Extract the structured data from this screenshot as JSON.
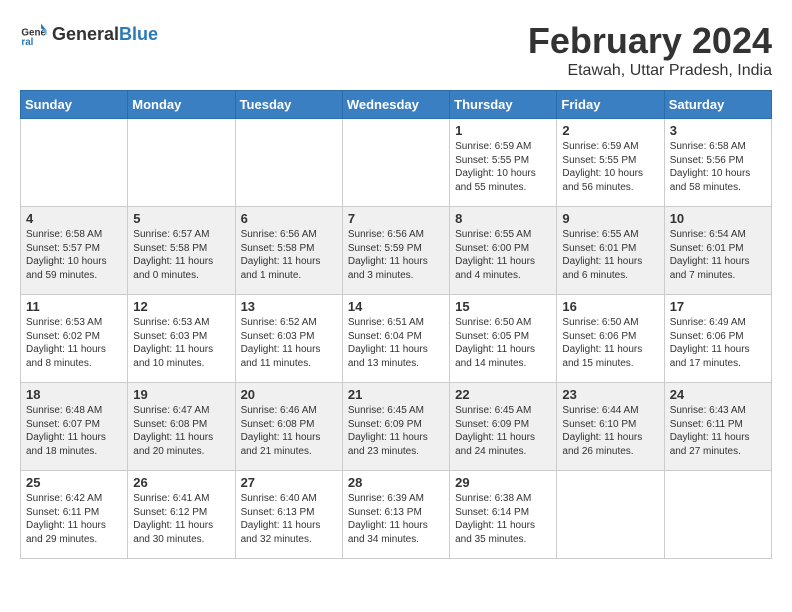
{
  "header": {
    "logo_general": "General",
    "logo_blue": "Blue",
    "month": "February 2024",
    "location": "Etawah, Uttar Pradesh, India"
  },
  "weekdays": [
    "Sunday",
    "Monday",
    "Tuesday",
    "Wednesday",
    "Thursday",
    "Friday",
    "Saturday"
  ],
  "weeks": [
    [
      {
        "day": "",
        "info": ""
      },
      {
        "day": "",
        "info": ""
      },
      {
        "day": "",
        "info": ""
      },
      {
        "day": "",
        "info": ""
      },
      {
        "day": "1",
        "info": "Sunrise: 6:59 AM\nSunset: 5:55 PM\nDaylight: 10 hours\nand 55 minutes."
      },
      {
        "day": "2",
        "info": "Sunrise: 6:59 AM\nSunset: 5:55 PM\nDaylight: 10 hours\nand 56 minutes."
      },
      {
        "day": "3",
        "info": "Sunrise: 6:58 AM\nSunset: 5:56 PM\nDaylight: 10 hours\nand 58 minutes."
      }
    ],
    [
      {
        "day": "4",
        "info": "Sunrise: 6:58 AM\nSunset: 5:57 PM\nDaylight: 10 hours\nand 59 minutes."
      },
      {
        "day": "5",
        "info": "Sunrise: 6:57 AM\nSunset: 5:58 PM\nDaylight: 11 hours\nand 0 minutes."
      },
      {
        "day": "6",
        "info": "Sunrise: 6:56 AM\nSunset: 5:58 PM\nDaylight: 11 hours\nand 1 minute."
      },
      {
        "day": "7",
        "info": "Sunrise: 6:56 AM\nSunset: 5:59 PM\nDaylight: 11 hours\nand 3 minutes."
      },
      {
        "day": "8",
        "info": "Sunrise: 6:55 AM\nSunset: 6:00 PM\nDaylight: 11 hours\nand 4 minutes."
      },
      {
        "day": "9",
        "info": "Sunrise: 6:55 AM\nSunset: 6:01 PM\nDaylight: 11 hours\nand 6 minutes."
      },
      {
        "day": "10",
        "info": "Sunrise: 6:54 AM\nSunset: 6:01 PM\nDaylight: 11 hours\nand 7 minutes."
      }
    ],
    [
      {
        "day": "11",
        "info": "Sunrise: 6:53 AM\nSunset: 6:02 PM\nDaylight: 11 hours\nand 8 minutes."
      },
      {
        "day": "12",
        "info": "Sunrise: 6:53 AM\nSunset: 6:03 PM\nDaylight: 11 hours\nand 10 minutes."
      },
      {
        "day": "13",
        "info": "Sunrise: 6:52 AM\nSunset: 6:03 PM\nDaylight: 11 hours\nand 11 minutes."
      },
      {
        "day": "14",
        "info": "Sunrise: 6:51 AM\nSunset: 6:04 PM\nDaylight: 11 hours\nand 13 minutes."
      },
      {
        "day": "15",
        "info": "Sunrise: 6:50 AM\nSunset: 6:05 PM\nDaylight: 11 hours\nand 14 minutes."
      },
      {
        "day": "16",
        "info": "Sunrise: 6:50 AM\nSunset: 6:06 PM\nDaylight: 11 hours\nand 15 minutes."
      },
      {
        "day": "17",
        "info": "Sunrise: 6:49 AM\nSunset: 6:06 PM\nDaylight: 11 hours\nand 17 minutes."
      }
    ],
    [
      {
        "day": "18",
        "info": "Sunrise: 6:48 AM\nSunset: 6:07 PM\nDaylight: 11 hours\nand 18 minutes."
      },
      {
        "day": "19",
        "info": "Sunrise: 6:47 AM\nSunset: 6:08 PM\nDaylight: 11 hours\nand 20 minutes."
      },
      {
        "day": "20",
        "info": "Sunrise: 6:46 AM\nSunset: 6:08 PM\nDaylight: 11 hours\nand 21 minutes."
      },
      {
        "day": "21",
        "info": "Sunrise: 6:45 AM\nSunset: 6:09 PM\nDaylight: 11 hours\nand 23 minutes."
      },
      {
        "day": "22",
        "info": "Sunrise: 6:45 AM\nSunset: 6:09 PM\nDaylight: 11 hours\nand 24 minutes."
      },
      {
        "day": "23",
        "info": "Sunrise: 6:44 AM\nSunset: 6:10 PM\nDaylight: 11 hours\nand 26 minutes."
      },
      {
        "day": "24",
        "info": "Sunrise: 6:43 AM\nSunset: 6:11 PM\nDaylight: 11 hours\nand 27 minutes."
      }
    ],
    [
      {
        "day": "25",
        "info": "Sunrise: 6:42 AM\nSunset: 6:11 PM\nDaylight: 11 hours\nand 29 minutes."
      },
      {
        "day": "26",
        "info": "Sunrise: 6:41 AM\nSunset: 6:12 PM\nDaylight: 11 hours\nand 30 minutes."
      },
      {
        "day": "27",
        "info": "Sunrise: 6:40 AM\nSunset: 6:13 PM\nDaylight: 11 hours\nand 32 minutes."
      },
      {
        "day": "28",
        "info": "Sunrise: 6:39 AM\nSunset: 6:13 PM\nDaylight: 11 hours\nand 34 minutes."
      },
      {
        "day": "29",
        "info": "Sunrise: 6:38 AM\nSunset: 6:14 PM\nDaylight: 11 hours\nand 35 minutes."
      },
      {
        "day": "",
        "info": ""
      },
      {
        "day": "",
        "info": ""
      }
    ]
  ]
}
